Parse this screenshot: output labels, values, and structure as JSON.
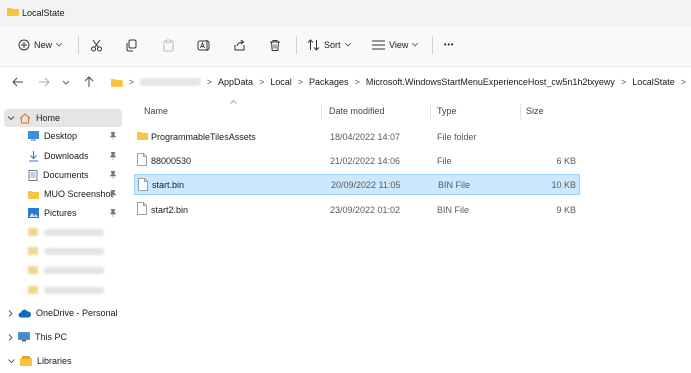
{
  "window": {
    "title": "LocalState"
  },
  "toolbar": {
    "new_label": "New",
    "sort_label": "Sort",
    "view_label": "View",
    "more_label": "•••"
  },
  "breadcrumb": {
    "separator": ">",
    "items": [
      "AppData",
      "Local",
      "Packages",
      "Microsoft.WindowsStartMenuExperienceHost_cw5n1h2txyewy",
      "LocalState"
    ],
    "end_chevron": ">"
  },
  "sidebar": {
    "home": "Home",
    "quick_access": [
      {
        "label": "Desktop",
        "icon": "desktop-icon"
      },
      {
        "label": "Downloads",
        "icon": "download-icon"
      },
      {
        "label": "Documents",
        "icon": "documents-icon"
      },
      {
        "label": "MUO Screenshot",
        "icon": "folder-icon"
      },
      {
        "label": "Pictures",
        "icon": "pictures-icon"
      }
    ],
    "onedrive": "OneDrive - Personal",
    "this_pc": "This PC",
    "libraries": "Libraries"
  },
  "columns": {
    "name": "Name",
    "date_modified": "Date modified",
    "type": "Type",
    "size": "Size"
  },
  "files": [
    {
      "name": "ProgrammableTilesAssets",
      "date": "18/04/2022 14:07",
      "type": "File folder",
      "size": "",
      "icon": "folder-icon"
    },
    {
      "name": "88000530",
      "date": "21/02/2022 14:06",
      "type": "File",
      "size": "6 KB",
      "icon": "file-icon"
    },
    {
      "name": "start.bin",
      "date": "20/09/2022 11:05",
      "type": "BIN File",
      "size": "10 KB",
      "icon": "file-icon"
    },
    {
      "name": "start2.bin",
      "date": "23/09/2022 01:02",
      "type": "BIN File",
      "size": "9 KB",
      "icon": "file-icon"
    }
  ],
  "colors": {
    "selection": "#cce8ff",
    "selection_border": "#99d1ff",
    "folder": "#f6c343",
    "accent": "#0067c0"
  }
}
